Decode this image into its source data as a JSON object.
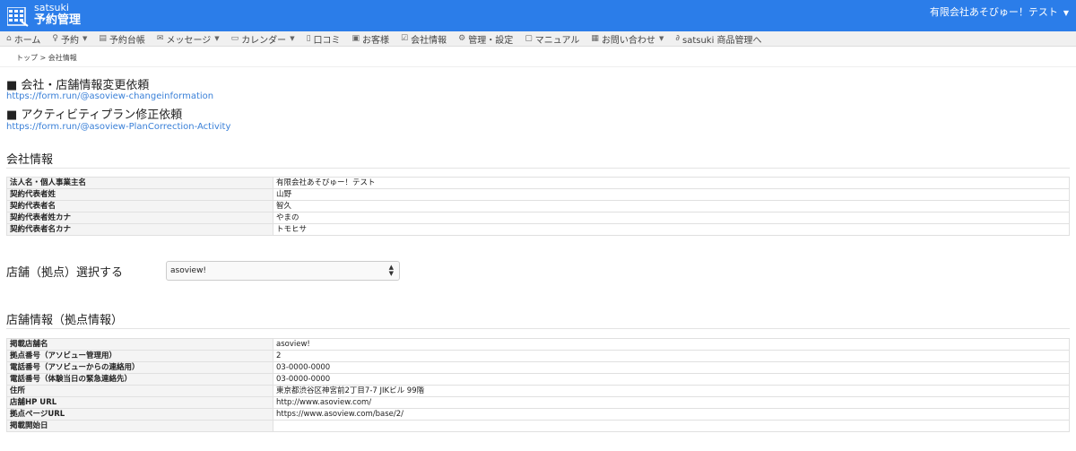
{
  "header": {
    "brand_sub": "satsuki",
    "brand_main": "予約管理",
    "account": "有限会社あそびゅー！テスト"
  },
  "nav": [
    {
      "icon": "home-icon",
      "glyph": "⌂",
      "label": "ホーム",
      "dropdown": false
    },
    {
      "icon": "lightbulb-icon",
      "glyph": "♀",
      "label": "予約",
      "dropdown": true
    },
    {
      "icon": "ledger-icon",
      "glyph": "▤",
      "label": "予約台帳",
      "dropdown": false
    },
    {
      "icon": "envelope-icon",
      "glyph": "✉",
      "label": "メッセージ",
      "dropdown": true
    },
    {
      "icon": "calendar-icon",
      "glyph": "▭",
      "label": "カレンダー",
      "dropdown": true
    },
    {
      "icon": "comment-icon",
      "glyph": "▯",
      "label": "口コミ",
      "dropdown": false
    },
    {
      "icon": "customer-icon",
      "glyph": "▣",
      "label": "お客様",
      "dropdown": false
    },
    {
      "icon": "check-icon",
      "glyph": "☑",
      "label": "会社情報",
      "dropdown": false
    },
    {
      "icon": "wrench-icon",
      "glyph": "⚙",
      "label": "管理・設定",
      "dropdown": false
    },
    {
      "icon": "book-icon",
      "glyph": "▢",
      "label": "マニュアル",
      "dropdown": false
    },
    {
      "icon": "inquiry-icon",
      "glyph": "▦",
      "label": "お問い合わせ",
      "dropdown": true
    },
    {
      "icon": "link-icon",
      "glyph": "∂",
      "label": "satsuki 商品管理へ",
      "dropdown": false
    }
  ],
  "breadcrumb": {
    "home": "トップ",
    "sep": " > ",
    "current": "会社情報"
  },
  "requests": [
    {
      "title": "■ 会社・店舗情報変更依頼",
      "url": "https://form.run/@asoview-changeinformation"
    },
    {
      "title": "■ アクティビティプラン修正依頼",
      "url": "https://form.run/@asoview-PlanCorrection-Activity"
    }
  ],
  "company": {
    "title": "会社情報",
    "rows": [
      {
        "key": "法人名・個人事業主名",
        "value": "有限会社あそびゅー！テスト"
      },
      {
        "key": "契約代表者姓",
        "value": "山野"
      },
      {
        "key": "契約代表者名",
        "value": "智久"
      },
      {
        "key": "契約代表者姓カナ",
        "value": "やまの"
      },
      {
        "key": "契約代表者名カナ",
        "value": "トモヒサ"
      }
    ]
  },
  "store_select": {
    "label": "店舗（拠点）選択する",
    "value": "asoview!"
  },
  "store": {
    "title": "店舗情報（拠点情報）",
    "rows": [
      {
        "key": "掲載店舗名",
        "value": "asoview!"
      },
      {
        "key": "拠点番号（アソビュー管理用）",
        "value": "2"
      },
      {
        "key": "電話番号（アソビューからの連絡用）",
        "value": "03-0000-0000"
      },
      {
        "key": "電話番号（体験当日の緊急連絡先）",
        "value": "03-0000-0000"
      },
      {
        "key": "住所",
        "value": "東京都渋谷区神宮前2丁目7-7 JIKビル 99階"
      },
      {
        "key": "店舗HP URL",
        "value": "http://www.asoview.com/"
      },
      {
        "key": "拠点ページURL",
        "value": "https://www.asoview.com/base/2/"
      },
      {
        "key": "掲載開始日",
        "value": ""
      }
    ]
  },
  "colors": {
    "header_bg": "#2b7de9",
    "link": "#3a80d8"
  }
}
